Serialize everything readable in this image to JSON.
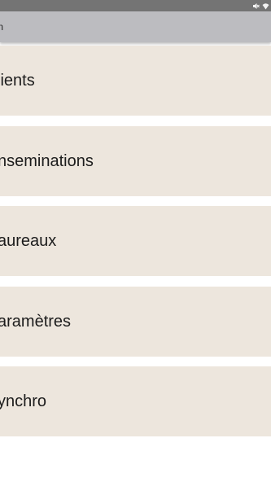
{
  "status_bar": {
    "icons": [
      "mute-icon",
      "wifi-icon"
    ]
  },
  "action_bar": {
    "title": "ation"
  },
  "menu": {
    "items": [
      {
        "label": "lients"
      },
      {
        "label": "nseminations"
      },
      {
        "label": "aureaux"
      },
      {
        "label": "aramètres"
      },
      {
        "label": "ynchro"
      }
    ]
  },
  "colors": {
    "status_bar": "#747474",
    "action_bar": "#bcbcc0",
    "menu_item_bg": "#ede6dd",
    "background": "#ffffff"
  }
}
